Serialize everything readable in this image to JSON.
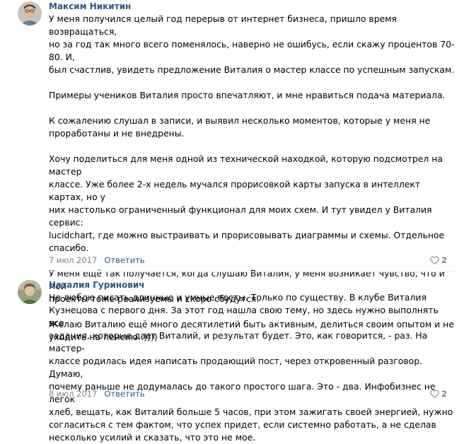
{
  "comments": [
    {
      "author": "Максим Никитин",
      "paragraphs": [
        "У меня получился целый год перерыв от интернет бизнеса, пришло время возвращаться,\nно за год так много всего поменялось, наверно не ошибусь, если скажу процентов 70-80. И,\nбыл счастлив, увидеть предложение Виталия о мастер классе по успешным запускам.",
        "Примеры учеников Виталия просто впечатляют, и мне нравиться подача материала.",
        "К сожалению слушал в записи, и выявил несколько моментов, которые у меня не\nпроработаны и не внедрены.",
        "Хочу поделиться для меня одной из технической находкой, которую подсмотрел на мастер\nклассе. Уже более 2-х недель мучался прорисовкой карты запуска в интеллект картах, но у\nних настолько ограниченный функционал для моих схем. И тут увидел у Виталия сервис:\nlucidchart, где можно выстраивать и прорисовывать диаграммы и схемы. Отдельное\nспасибо.",
        "У меня ещё так получается, когда слушаю Виталия, у меня возникает чувство, что и мои\nпроекты тоже реализуемы и скоро сбудутся.",
        "Желаю Виталию ещё много десятилетий быть активным, делиться своим опытом и не\nуходить на пенсию :))))"
      ],
      "date": "7 июл 2017",
      "reply_label": "Ответить",
      "likes": "2"
    },
    {
      "author": "Наталия Гуринович",
      "paragraphs": [
        "Не люблю писать длинные и умные посты. Только по существу. В клубе Виталия\nКузнецова с первого дня. За этот год нашла свою тему, но здесь нужно выполнять все\nзадания, которые дает Виталий, и результат будет. Это, как говорится, - раз. На мастер-\nклассе родилась идея написать продающий пост, через откровенный разговор. Думаю,\nпочему раньше не додумалась до такого простого шага. Это - два. Инфобизнес не легок\nхлеб, вещать, как Виталий больше 5 часов, при этом зажигать своей энергией, нужно\nсогласиться с тем фактом, что успех придет, если системно работать, а не сделав\nнесколько усилий и сказать, что это не мое."
      ],
      "date": "8 июл 2017",
      "reply_label": "Ответить",
      "likes": "2"
    }
  ],
  "colors": {
    "link": "#2a5885",
    "meta": "#828282",
    "divider": "#e7e8ec"
  },
  "icons": {
    "like": "heart-icon"
  }
}
